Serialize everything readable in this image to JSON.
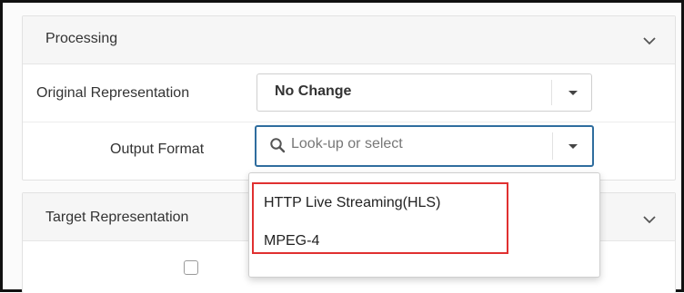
{
  "processing": {
    "title": "Processing",
    "original_representation": {
      "label": "Original Representation",
      "value": "No Change"
    },
    "output_format": {
      "label": "Output Format",
      "placeholder": "Look-up or select"
    }
  },
  "target": {
    "title": "Target Representation"
  },
  "dropdown": {
    "options": [
      "HTTP Live Streaming(HLS)",
      "MPEG-4"
    ]
  },
  "colors": {
    "focus_border": "#2f6d9e",
    "highlight_border": "#e03030"
  }
}
